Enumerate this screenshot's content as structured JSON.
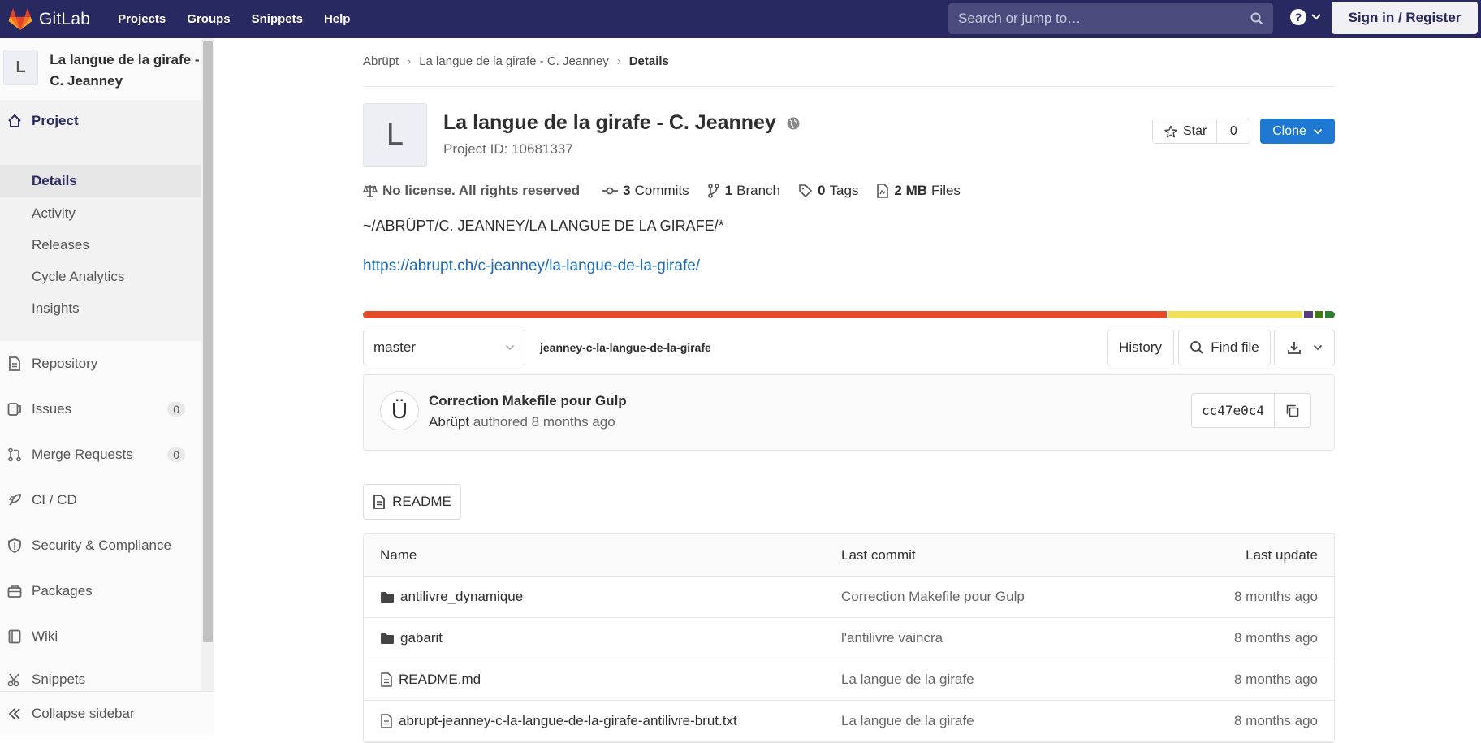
{
  "navbar": {
    "brand": "GitLab",
    "links": [
      "Projects",
      "Groups",
      "Snippets",
      "Help"
    ],
    "search_placeholder": "Search or jump to…",
    "signin_label": "Sign in / Register"
  },
  "sidebar": {
    "project_avatar_letter": "L",
    "project_name": "La langue de la girafe - C. Jeanney",
    "project_label": "Project",
    "project_subitems": [
      "Details",
      "Activity",
      "Releases",
      "Cycle Analytics",
      "Insights"
    ],
    "items": [
      {
        "label": "Repository",
        "icon": "doc-icon"
      },
      {
        "label": "Issues",
        "icon": "issues-icon",
        "count": "0"
      },
      {
        "label": "Merge Requests",
        "icon": "merge-request-icon",
        "count": "0"
      },
      {
        "label": "CI / CD",
        "icon": "rocket-icon"
      },
      {
        "label": "Security & Compliance",
        "icon": "shield-icon"
      },
      {
        "label": "Packages",
        "icon": "package-icon"
      },
      {
        "label": "Wiki",
        "icon": "book-icon"
      },
      {
        "label": "Snippets",
        "icon": "scissors-icon"
      }
    ],
    "collapse_label": "Collapse sidebar"
  },
  "breadcrumb": [
    "Abrüpt",
    "La langue de la girafe - C. Jeanney",
    "Details"
  ],
  "project": {
    "avatar_letter": "L",
    "title": "La langue de la girafe - C. Jeanney",
    "id_text": "Project ID: 10681337",
    "star_label": "Star",
    "star_count": "0",
    "clone_label": "Clone",
    "stats": {
      "license": "No license. All rights reserved",
      "commits_count": "3",
      "commits_label": "Commits",
      "branch_count": "1",
      "branch_label": "Branch",
      "tags_count": "0",
      "tags_label": "Tags",
      "files_size": "2 MB",
      "files_label": "Files"
    },
    "description": "~/ABRÜPT/C. JEANNEY/LA LANGUE DE LA GIRAFE/*",
    "link": "https://abrupt.ch/c-jeanney/la-langue-de-la-girafe/"
  },
  "languages": [
    {
      "share": 83.3,
      "color": "#e34c26"
    },
    {
      "share": 13.8,
      "color": "#f1e05a"
    },
    {
      "share": 1.0,
      "color": "#563d7c"
    },
    {
      "share": 0.9,
      "color": "#427819"
    },
    {
      "share": 1.0,
      "color": "#2e7d32"
    }
  ],
  "controls": {
    "branch": "master",
    "path": "jeanney-c-la-langue-de-la-girafe",
    "history_label": "History",
    "find_file_label": "Find file"
  },
  "last_commit": {
    "avatar_char": "Ü",
    "title": "Correction Makefile pour Gulp",
    "author": "Abrüpt",
    "meta": "authored 8 months ago",
    "sha": "cc47e0c4"
  },
  "readme_label": "README",
  "tree": {
    "headers": {
      "name": "Name",
      "commit": "Last commit",
      "update": "Last update"
    },
    "rows": [
      {
        "name": "antilivre_dynamique",
        "type": "folder",
        "commit": "Correction Makefile pour Gulp",
        "update": "8 months ago"
      },
      {
        "name": "gabarit",
        "type": "folder",
        "commit": "l'antilivre vaincra",
        "update": "8 months ago"
      },
      {
        "name": "README.md",
        "type": "file",
        "commit": "La langue de la girafe",
        "update": "8 months ago"
      },
      {
        "name": "abrupt-jeanney-c-la-langue-de-la-girafe-antilivre-brut.txt",
        "type": "file",
        "commit": "La langue de la girafe",
        "update": "8 months ago"
      }
    ]
  }
}
